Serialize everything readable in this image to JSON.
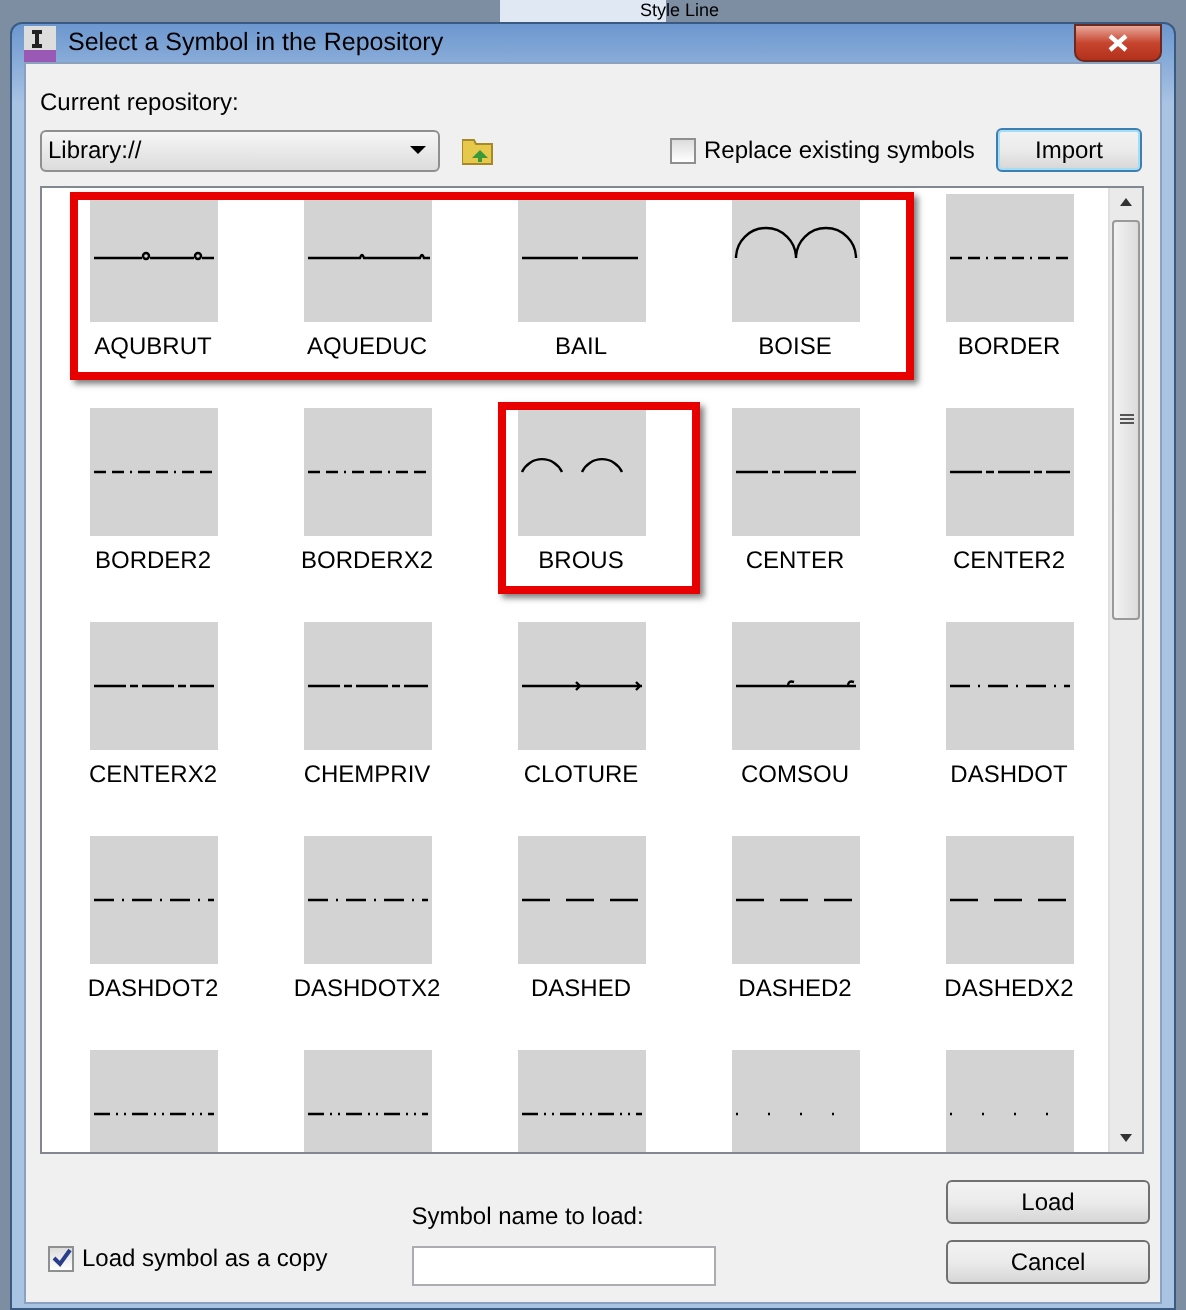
{
  "background_window": {
    "title": "Style Line"
  },
  "window": {
    "title": "Select a Symbol in the Repository"
  },
  "repository": {
    "label": "Current repository:",
    "value": "Library://"
  },
  "replace_existing": {
    "label": "Replace existing symbols",
    "checked": false
  },
  "import_button": "Import",
  "symbols": [
    {
      "name": "AQUBRUT",
      "kind": "loops",
      "highlighted": true
    },
    {
      "name": "AQUEDUC",
      "kind": "bumps",
      "highlighted": true
    },
    {
      "name": "BAIL",
      "kind": "long-dash",
      "highlighted": true
    },
    {
      "name": "BOISE",
      "kind": "arcs",
      "highlighted": true
    },
    {
      "name": "BORDER",
      "kind": "dash-dash-dot",
      "highlighted": false
    },
    {
      "name": "BORDER2",
      "kind": "dash-dash-dot",
      "highlighted": false
    },
    {
      "name": "BORDERX2",
      "kind": "dash-dash-dot",
      "highlighted": false
    },
    {
      "name": "BROUS",
      "kind": "gapped-arcs",
      "highlighted": true
    },
    {
      "name": "CENTER",
      "kind": "center",
      "highlighted": false
    },
    {
      "name": "CENTER2",
      "kind": "center",
      "highlighted": false
    },
    {
      "name": "CENTERX2",
      "kind": "center",
      "highlighted": false
    },
    {
      "name": "CHEMPRIV",
      "kind": "center",
      "highlighted": false
    },
    {
      "name": "CLOTURE",
      "kind": "crosses",
      "highlighted": false
    },
    {
      "name": "COMSOU",
      "kind": "hooks",
      "highlighted": false
    },
    {
      "name": "DASHDOT",
      "kind": "dash-dot",
      "highlighted": false
    },
    {
      "name": "DASHDOT2",
      "kind": "dash-dot",
      "highlighted": false
    },
    {
      "name": "DASHDOTX2",
      "kind": "dash-dot",
      "highlighted": false
    },
    {
      "name": "DASHED",
      "kind": "dashed",
      "highlighted": false
    },
    {
      "name": "DASHED2",
      "kind": "dashed",
      "highlighted": false
    },
    {
      "name": "DASHEDX2",
      "kind": "dashed",
      "highlighted": false
    },
    {
      "kind": "divide",
      "highlighted": false
    },
    {
      "kind": "divide",
      "highlighted": false
    },
    {
      "kind": "divide",
      "highlighted": false
    },
    {
      "kind": "dotted",
      "highlighted": false
    },
    {
      "kind": "dotted",
      "highlighted": false
    }
  ],
  "name_to_load": {
    "label": "Symbol name to load:"
  },
  "load_as_copy": {
    "label": "Load symbol as a copy",
    "checked": true
  },
  "buttons": [
    "Load",
    "Cancel"
  ]
}
